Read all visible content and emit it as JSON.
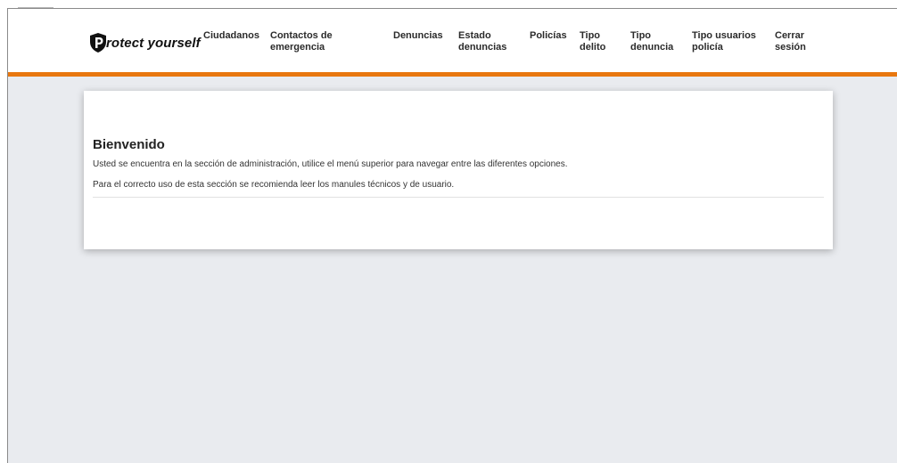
{
  "brand": {
    "logo_text": "rotect yourself",
    "logo_icon": "shield-p-icon"
  },
  "nav": [
    {
      "label": "Ciudadanos"
    },
    {
      "label": "Contactos de emergencia"
    },
    {
      "label": "Denuncias"
    },
    {
      "label": "Estado denuncias"
    },
    {
      "label": "Policías"
    },
    {
      "label": "Tipo delito"
    },
    {
      "label": "Tipo denuncia"
    },
    {
      "label": "Tipo usuarios policía"
    },
    {
      "label": "Cerrar sesión"
    }
  ],
  "welcome": {
    "title": "Bienvenido",
    "line1": "Usted se encuentra en la sección de administración, utilice el menú superior para navegar entre las diferentes opciones.",
    "line2": "Para el correcto uso de esta sección se recomienda leer los manules técnicos y de usuario."
  },
  "colors": {
    "accent": "#e8770f",
    "background": "#e9ebef"
  }
}
